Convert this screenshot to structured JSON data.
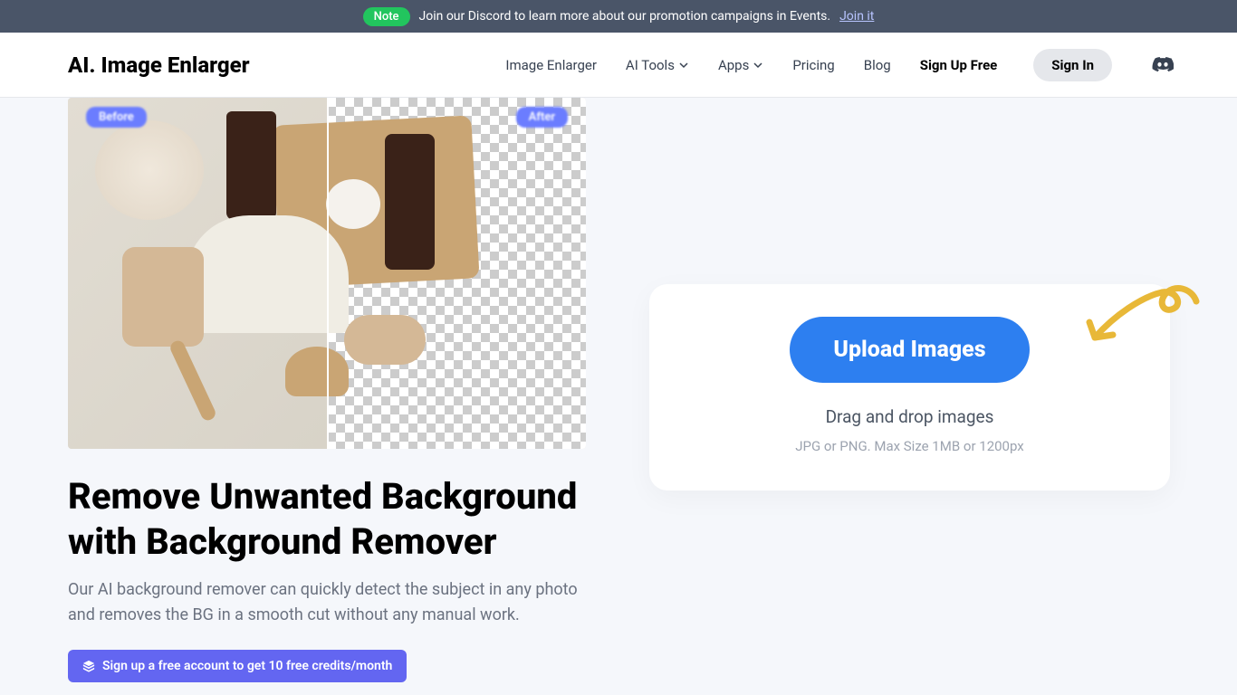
{
  "banner": {
    "note": "Note",
    "text": "Join our Discord to learn more about our promotion campaigns in Events.",
    "link": "Join it"
  },
  "nav": {
    "logo": "AI. Image Enlarger",
    "links": [
      "Image Enlarger",
      "AI Tools",
      "Apps",
      "Pricing",
      "Blog"
    ],
    "signup": "Sign Up Free",
    "signin": "Sign In"
  },
  "hero": {
    "before": "Before",
    "after": "After",
    "heading": "Remove Unwanted Background with Background Remover",
    "description": "Our AI background remover can quickly detect the subject in any photo and removes the BG in a smooth cut without any manual work.",
    "cta": "Sign up a free account to get 10 free credits/month"
  },
  "upload": {
    "button": "Upload Images",
    "drag": "Drag and drop images",
    "hint": "JPG or PNG. Max Size 1MB or 1200px"
  }
}
